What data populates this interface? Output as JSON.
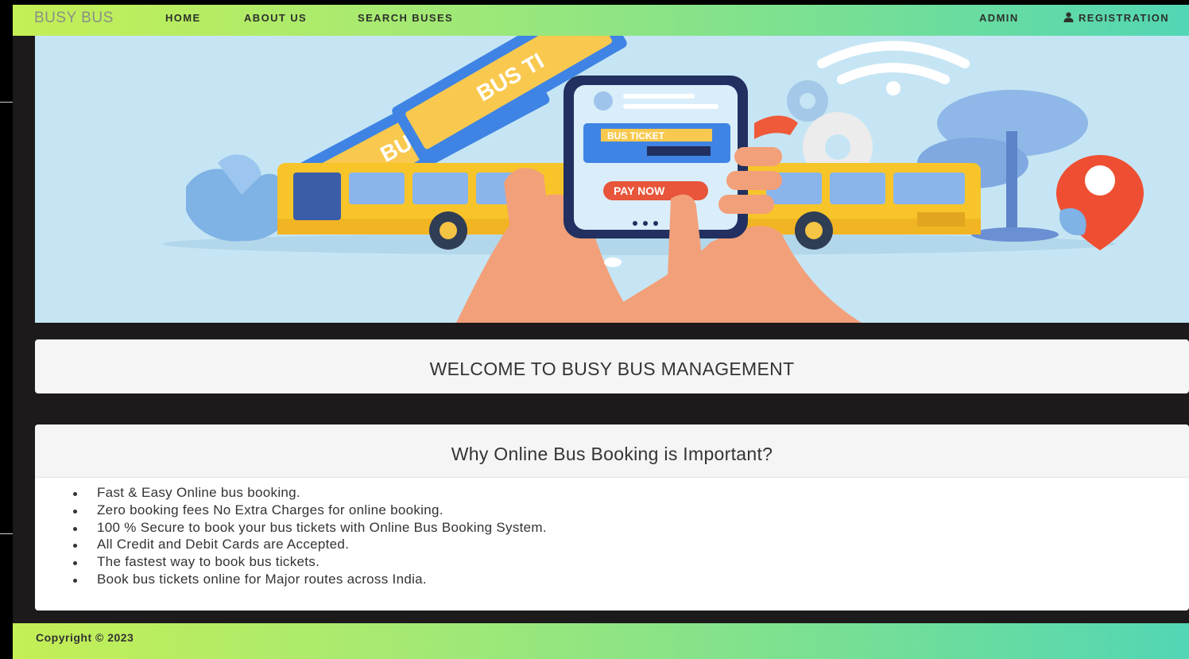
{
  "navbar": {
    "brand": "BUSY BUS",
    "links": [
      "HOME",
      "ABOUT US",
      "SEARCH BUSES"
    ],
    "admin": "ADMIN",
    "registration": "REGISTRATION",
    "registration_icon": "user-icon"
  },
  "hero": {
    "ticket_text_1": "BUS TIC",
    "ticket_text_2": "BUS TI",
    "phone_ticket_label": "BUS TICKET",
    "pay_button": "PAY NOW"
  },
  "welcome": {
    "title": "WELCOME TO BUSY BUS MANAGEMENT"
  },
  "why": {
    "title": "Why Online Bus Booking is Important?",
    "items": [
      "Fast & Easy Online bus booking.",
      "Zero booking fees No Extra Charges for online booking.",
      "100 % Secure to book your bus tickets with Online Bus Booking System.",
      "All Credit and Debit Cards are Accepted.",
      "The fastest way to book bus tickets.",
      "Book bus tickets online for Major routes across India."
    ]
  },
  "footer": {
    "copyright": "Copyright © 2023"
  },
  "colors": {
    "nav_gradient_start": "#c4ef55",
    "nav_gradient_end": "#52d6b4",
    "hero_bg": "#c6e5f4",
    "bus_yellow": "#f7c52a",
    "pay_button": "#e8553a",
    "page_bg": "#1c1a1b"
  }
}
